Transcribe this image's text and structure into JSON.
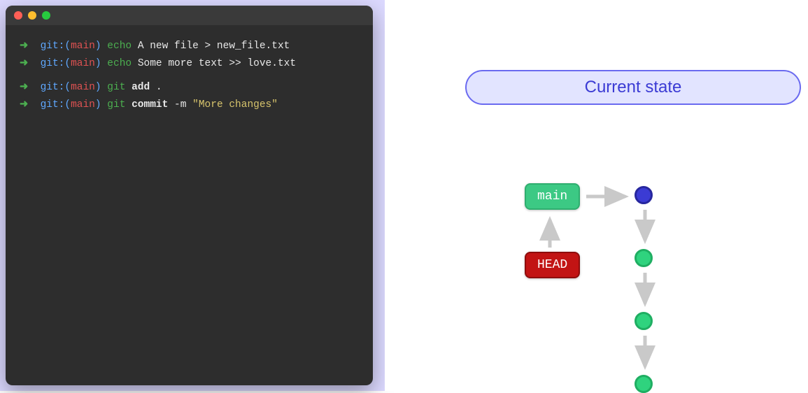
{
  "terminal": {
    "lines": [
      {
        "arrow": "➜",
        "prefix": "git:",
        "branch": "main",
        "cmd": "echo",
        "rest": "A new file > new_file.txt"
      },
      {
        "arrow": "➜",
        "prefix": "git:",
        "branch": "main",
        "cmd": "echo",
        "rest": "Some more text >> love.txt"
      },
      {
        "spacer": true
      },
      {
        "arrow": "➜",
        "prefix": "git:",
        "branch": "main",
        "cmd": "git",
        "sub": "add",
        "rest": "."
      },
      {
        "arrow": "➜",
        "prefix": "git:",
        "branch": "main",
        "cmd": "git",
        "sub": "commit",
        "flag": "-m",
        "string": "\"More changes\""
      }
    ]
  },
  "diagram": {
    "title": "Current state",
    "main_label": "main",
    "head_label": "HEAD",
    "commits": [
      "c1-blue",
      "c2-green",
      "c3-green",
      "c4-green"
    ]
  },
  "colors": {
    "terminal_bg": "#2d2d2d",
    "accent_blue": "#3b3bd4",
    "accent_green": "#3cc984",
    "accent_red": "#c21414",
    "arrow_gray": "#c9c9c9"
  }
}
